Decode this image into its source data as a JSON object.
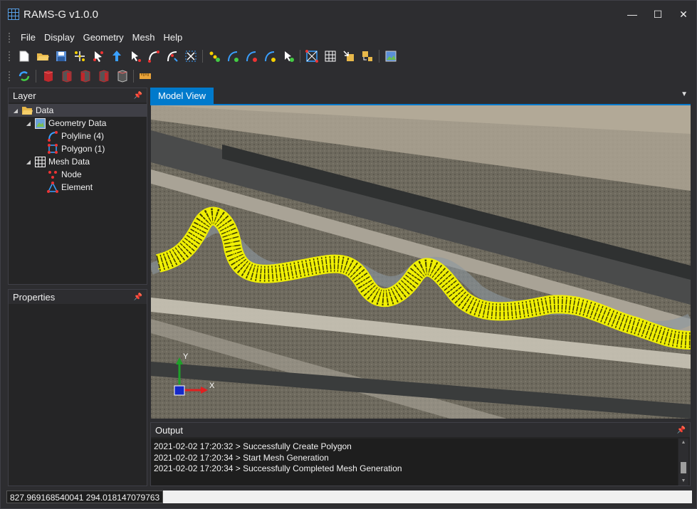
{
  "window": {
    "title": "RAMS-G v1.0.0",
    "minimize_glyph": "—",
    "maximize_glyph": "☐",
    "close_glyph": "✕"
  },
  "menu": [
    "File",
    "Display",
    "Geometry",
    "Mesh",
    "Help"
  ],
  "layer_panel": {
    "title": "Layer",
    "tree": {
      "root": "Data",
      "geometry_label": "Geometry Data",
      "polyline_label": "Polyline (4)",
      "polygon_label": "Polygon (1)",
      "mesh_label": "Mesh Data",
      "node_label": "Node",
      "element_label": "Element"
    }
  },
  "properties_panel": {
    "title": "Properties"
  },
  "model_view": {
    "tab_label": "Model View",
    "axis_y": "Y",
    "axis_x": "X"
  },
  "output": {
    "title": "Output",
    "lines": [
      "2021-02-02 17:20:32 > Successfully Create Polygon",
      "2021-02-02 17:20:34 > Start Mesh Generation",
      "2021-02-02 17:20:34 > Successfully Completed Mesh Generation"
    ]
  },
  "status": {
    "coordinates": "827.969168540041 294.018147079763"
  },
  "colors": {
    "accent": "#007acc",
    "mesh": "#f5f500",
    "background": "#2d2d30"
  }
}
